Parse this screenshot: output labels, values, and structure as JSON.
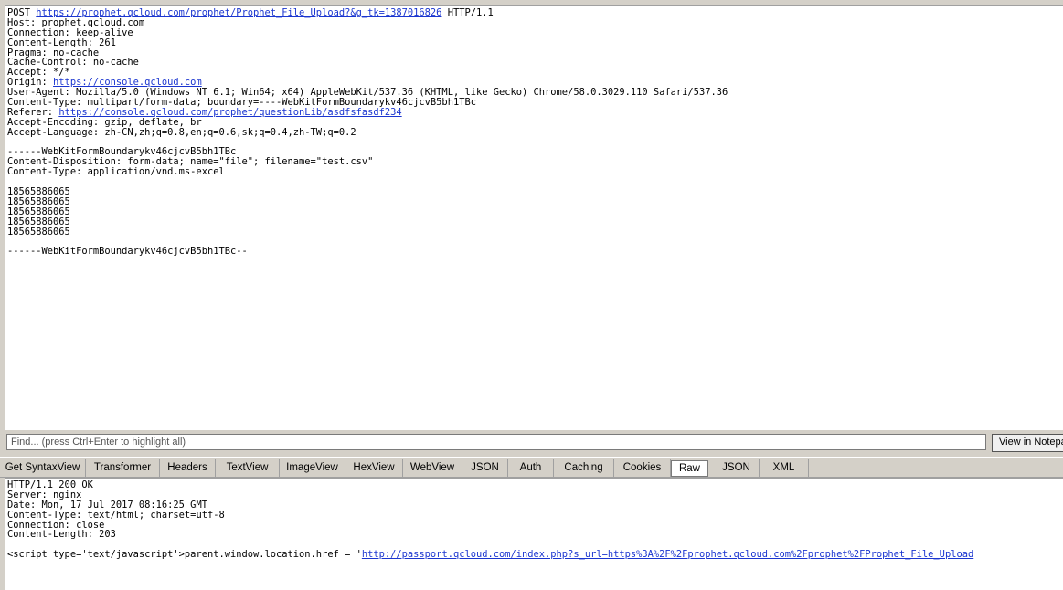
{
  "request": {
    "lines": [
      [
        {
          "t": "POST "
        },
        {
          "t": "https://prophet.qcloud.com/prophet/Prophet_File_Upload?&g_tk=1387016826",
          "link": true
        },
        {
          "t": " HTTP/1.1"
        }
      ],
      [
        {
          "t": "Host: prophet.qcloud.com"
        }
      ],
      [
        {
          "t": "Connection: keep-alive"
        }
      ],
      [
        {
          "t": "Content-Length: 261"
        }
      ],
      [
        {
          "t": "Pragma: no-cache"
        }
      ],
      [
        {
          "t": "Cache-Control: no-cache"
        }
      ],
      [
        {
          "t": "Accept: */*"
        }
      ],
      [
        {
          "t": "Origin: "
        },
        {
          "t": "https://console.qcloud.com",
          "link": true
        }
      ],
      [
        {
          "t": "User-Agent: Mozilla/5.0 (Windows NT 6.1; Win64; x64) AppleWebKit/537.36 (KHTML, like Gecko) Chrome/58.0.3029.110 Safari/537.36"
        }
      ],
      [
        {
          "t": "Content-Type: multipart/form-data; boundary=----WebKitFormBoundarykv46cjcvB5bh1TBc"
        }
      ],
      [
        {
          "t": "Referer: "
        },
        {
          "t": "https://console.qcloud.com/prophet/questionLib/asdfsfasdf234",
          "link": true
        }
      ],
      [
        {
          "t": "Accept-Encoding: gzip, deflate, br"
        }
      ],
      [
        {
          "t": "Accept-Language: zh-CN,zh;q=0.8,en;q=0.6,sk;q=0.4,zh-TW;q=0.2"
        }
      ],
      [
        {
          "t": ""
        }
      ],
      [
        {
          "t": "------WebKitFormBoundarykv46cjcvB5bh1TBc"
        }
      ],
      [
        {
          "t": "Content-Disposition: form-data; name=\"file\"; filename=\"test.csv\""
        }
      ],
      [
        {
          "t": "Content-Type: application/vnd.ms-excel"
        }
      ],
      [
        {
          "t": ""
        }
      ],
      [
        {
          "t": "18565886065"
        }
      ],
      [
        {
          "t": "18565886065"
        }
      ],
      [
        {
          "t": "18565886065"
        }
      ],
      [
        {
          "t": "18565886065"
        }
      ],
      [
        {
          "t": "18565886065"
        }
      ],
      [
        {
          "t": ""
        }
      ],
      [
        {
          "t": "------WebKitFormBoundarykv46cjcvB5bh1TBc--"
        }
      ]
    ]
  },
  "find": {
    "placeholder": "Find... (press Ctrl+Enter to highlight all)",
    "notepad_label": "View in Notepad"
  },
  "tabs": [
    {
      "label": "Get SyntaxView",
      "active": false
    },
    {
      "label": "Transformer",
      "active": false
    },
    {
      "label": "Headers",
      "active": false
    },
    {
      "label": "TextView",
      "active": false
    },
    {
      "label": "ImageView",
      "active": false
    },
    {
      "label": "HexView",
      "active": false
    },
    {
      "label": "WebView",
      "active": false
    },
    {
      "label": "JSON",
      "active": false
    },
    {
      "label": "Auth",
      "active": false
    },
    {
      "label": "Caching",
      "active": false
    },
    {
      "label": "Cookies",
      "active": false
    },
    {
      "label": "Raw",
      "active": true
    },
    {
      "label": "JSON",
      "active": false
    },
    {
      "label": "XML",
      "active": false
    }
  ],
  "response": {
    "lines": [
      [
        {
          "t": "HTTP/1.1 200 OK"
        }
      ],
      [
        {
          "t": "Server: nginx"
        }
      ],
      [
        {
          "t": "Date: Mon, 17 Jul 2017 08:16:25 GMT"
        }
      ],
      [
        {
          "t": "Content-Type: text/html; charset=utf-8"
        }
      ],
      [
        {
          "t": "Connection: close"
        }
      ],
      [
        {
          "t": "Content-Length: 203"
        }
      ],
      [
        {
          "t": ""
        }
      ],
      [
        {
          "t": "<script type='text/javascript'>parent.window.location.href = '"
        },
        {
          "t": "http://passport.qcloud.com/index.php?s_url=https%3A%2F%2Fprophet.qcloud.com%2Fprophet%2FProphet_File_Upload",
          "link": true
        }
      ]
    ]
  }
}
